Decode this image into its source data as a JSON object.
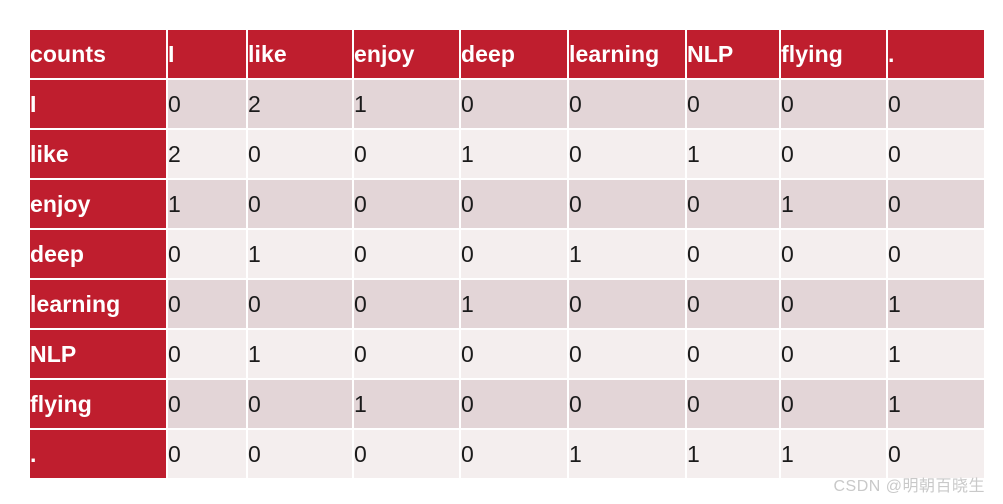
{
  "table": {
    "corner_label": "counts",
    "columns": [
      "I",
      "like",
      "enjoy",
      "deep",
      "learning",
      "NLP",
      "flying",
      "."
    ],
    "rows": [
      {
        "label": "I",
        "values": [
          0,
          2,
          1,
          0,
          0,
          0,
          0,
          0
        ]
      },
      {
        "label": "like",
        "values": [
          2,
          0,
          0,
          1,
          0,
          1,
          0,
          0
        ]
      },
      {
        "label": "enjoy",
        "values": [
          1,
          0,
          0,
          0,
          0,
          0,
          1,
          0
        ]
      },
      {
        "label": "deep",
        "values": [
          0,
          1,
          0,
          0,
          1,
          0,
          0,
          0
        ]
      },
      {
        "label": "learning",
        "values": [
          0,
          0,
          0,
          1,
          0,
          0,
          0,
          1
        ]
      },
      {
        "label": "NLP",
        "values": [
          0,
          1,
          0,
          0,
          0,
          0,
          0,
          1
        ]
      },
      {
        "label": "flying",
        "values": [
          0,
          0,
          1,
          0,
          0,
          0,
          0,
          1
        ]
      },
      {
        "label": ".",
        "values": [
          0,
          0,
          0,
          0,
          1,
          1,
          1,
          0
        ]
      }
    ]
  },
  "watermark": {
    "text": "CSDN @明朝百晓生"
  },
  "colors": {
    "header_red": "#bf1e2e",
    "band_dark": "#e3d5d7",
    "band_light": "#f4eeee",
    "page_background": "#ffffff",
    "watermark_gray": "#c9c9c9"
  }
}
